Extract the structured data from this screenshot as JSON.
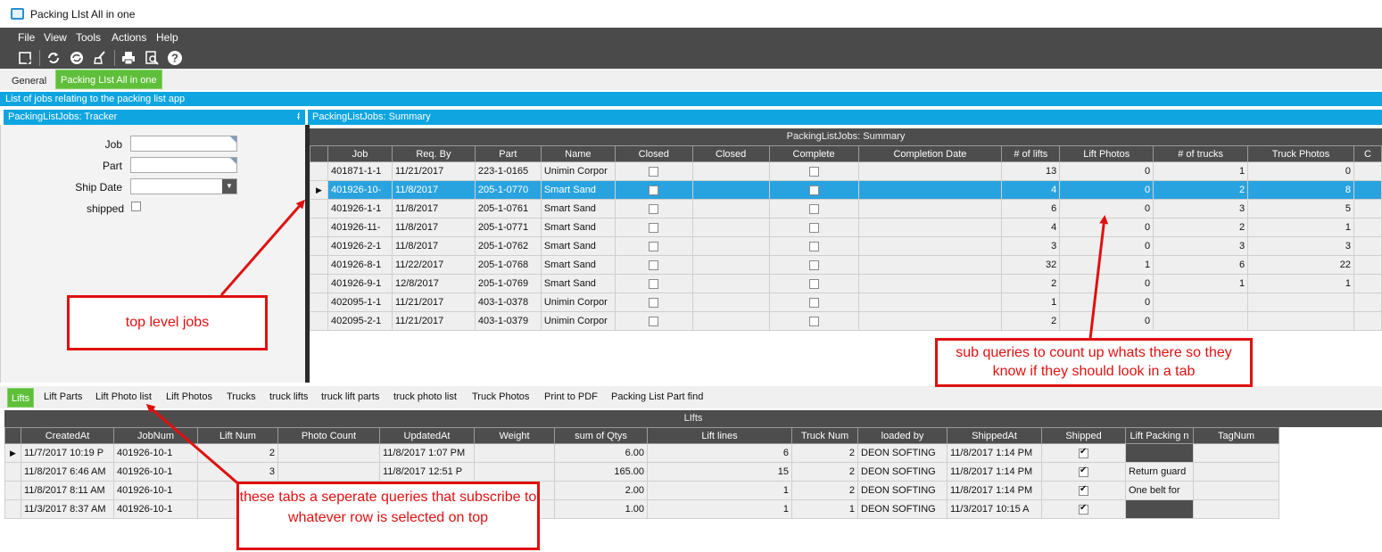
{
  "window": {
    "title": "Packing LIst All in one"
  },
  "menu": [
    "File",
    "View",
    "Tools",
    "Actions",
    "Help"
  ],
  "toolbar": {
    "icons": [
      "new-icon",
      "refresh-icon",
      "refresh-all-icon",
      "clear-icon",
      "print-icon",
      "print-preview-icon",
      "help-icon"
    ]
  },
  "tabs": {
    "general": "General",
    "active": "Packing LIst All in one"
  },
  "description": "List of jobs relating to the packing list app",
  "tracker": {
    "title": "PackingListJobs: Tracker",
    "pin": "ᵮ",
    "job_label": "Job",
    "part_label": "Part",
    "shipdate_label": "Ship Date",
    "shipped_label": "shipped",
    "date_btn": "▼"
  },
  "summary": {
    "title": "PackingListJobs: Summary",
    "caption": "PackingListJobs: Summary",
    "columns": [
      "Job",
      "Req. By",
      "Part",
      "Name",
      "Closed",
      "Closed",
      "Complete",
      "Completion Date",
      "# of lifts",
      "Lift Photos",
      "# of trucks",
      "Truck Photos",
      "C"
    ],
    "rows": [
      {
        "job": "401871-1-1",
        "req": "11/21/2017",
        "part": "223-1-0165",
        "name": "Unimin Corpor",
        "lifts": "13",
        "lphotos": "0",
        "trucks": "1",
        "tphotos": "0"
      },
      {
        "job": "401926-10-",
        "req": "11/8/2017",
        "part": "205-1-0770",
        "name": "Smart Sand",
        "lifts": "4",
        "lphotos": "0",
        "trucks": "2",
        "tphotos": "8"
      },
      {
        "job": "401926-1-1",
        "req": "11/8/2017",
        "part": "205-1-0761",
        "name": "Smart Sand",
        "lifts": "6",
        "lphotos": "0",
        "trucks": "3",
        "tphotos": "5"
      },
      {
        "job": "401926-11-",
        "req": "11/8/2017",
        "part": "205-1-0771",
        "name": "Smart Sand",
        "lifts": "4",
        "lphotos": "0",
        "trucks": "2",
        "tphotos": "1"
      },
      {
        "job": "401926-2-1",
        "req": "11/8/2017",
        "part": "205-1-0762",
        "name": "Smart Sand",
        "lifts": "3",
        "lphotos": "0",
        "trucks": "3",
        "tphotos": "3"
      },
      {
        "job": "401926-8-1",
        "req": "11/22/2017",
        "part": "205-1-0768",
        "name": "Smart Sand",
        "lifts": "32",
        "lphotos": "1",
        "trucks": "6",
        "tphotos": "22"
      },
      {
        "job": "401926-9-1",
        "req": "12/8/2017",
        "part": "205-1-0769",
        "name": "Smart Sand",
        "lifts": "2",
        "lphotos": "0",
        "trucks": "1",
        "tphotos": "1"
      },
      {
        "job": "402095-1-1",
        "req": "11/21/2017",
        "part": "403-1-0378",
        "name": "Unimin Corpor",
        "lifts": "1",
        "lphotos": "0",
        "trucks": "",
        "tphotos": ""
      },
      {
        "job": "402095-2-1",
        "req": "11/21/2017",
        "part": "403-1-0379",
        "name": "Unimin Corpor",
        "lifts": "2",
        "lphotos": "0",
        "trucks": "",
        "tphotos": ""
      }
    ],
    "selected_index": 1
  },
  "bottom_tabs": [
    "Lifts",
    "Lift Parts",
    "Lift Photo list",
    "Lift Photos",
    "Trucks",
    "truck lifts",
    "truck lift parts",
    "truck photo list",
    "Truck Photos",
    "Print to PDF",
    "Packing List Part find"
  ],
  "lifts": {
    "caption": "LIfts",
    "columns": [
      "CreatedAt",
      "JobNum",
      "Lift Num",
      "Photo Count",
      "UpdatedAt",
      "Weight",
      "sum of Qtys",
      "Lift lines",
      "Truck Num",
      "loaded by",
      "ShippedAt",
      "Shipped",
      "Lift Packing n",
      "TagNum"
    ],
    "rows": [
      {
        "created": "11/7/2017 10:19 P",
        "job": "401926-10-1",
        "lift": "2",
        "photos": "",
        "updated": "11/8/2017 1:07 PM",
        "weight": "",
        "qtys": "6.00",
        "lines": "6",
        "truck": "2",
        "loaded": "DEON SOFTING",
        "shipped_at": "11/8/2017 1:14 PM",
        "packing": "",
        "tag": ""
      },
      {
        "created": "11/8/2017 6:46 AM",
        "job": "401926-10-1",
        "lift": "3",
        "photos": "",
        "updated": "11/8/2017 12:51 P",
        "weight": "",
        "qtys": "165.00",
        "lines": "15",
        "truck": "2",
        "loaded": "DEON SOFTING",
        "shipped_at": "11/8/2017 1:14 PM",
        "packing": "Return guard",
        "tag": ""
      },
      {
        "created": "11/8/2017 8:11 AM",
        "job": "401926-10-1",
        "lift": "",
        "photos": "",
        "updated": "",
        "weight": "",
        "qtys": "2.00",
        "lines": "1",
        "truck": "2",
        "loaded": "DEON SOFTING",
        "shipped_at": "11/8/2017 1:14 PM",
        "packing": "One belt for",
        "tag": ""
      },
      {
        "created": "11/3/2017 8:37 AM",
        "job": "401926-10-1",
        "lift": "",
        "photos": "",
        "updated": "",
        "weight": "",
        "qtys": "1.00",
        "lines": "1",
        "truck": "1",
        "loaded": "DEON SOFTING",
        "shipped_at": "11/3/2017 10:15 A",
        "packing": "",
        "tag": ""
      }
    ]
  },
  "annotations": {
    "top_level": "top level jobs",
    "sub_queries": "sub queries to count up whats there so they know if they should look in a tab",
    "tabs_note": "these tabs a seperate queries that subscribe to whatever row is selected on top"
  },
  "colors": {
    "accent": "#0ea5e0",
    "selection": "#29a3df",
    "active_tab": "#5fbf3a",
    "annotation": "#e01010",
    "chrome": "#4a4a4a"
  }
}
